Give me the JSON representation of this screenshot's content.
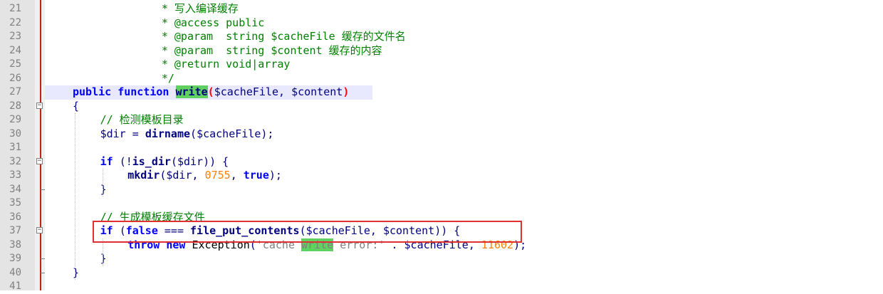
{
  "editor": {
    "lines": [
      {
        "n": "21",
        "tokens": [
          [
            "c-comment",
            " * 写入编译缓存"
          ]
        ],
        "indent": 12
      },
      {
        "n": "22",
        "tokens": [
          [
            "c-comment",
            " * @access public"
          ]
        ],
        "indent": 12
      },
      {
        "n": "23",
        "tokens": [
          [
            "c-comment",
            " * @param  string $cacheFile 缓存的文件名"
          ]
        ],
        "indent": 12
      },
      {
        "n": "24",
        "tokens": [
          [
            "c-comment",
            " * @param  string $content 缓存的内容"
          ]
        ],
        "indent": 12
      },
      {
        "n": "25",
        "tokens": [
          [
            "c-comment",
            " * @return void|array"
          ]
        ],
        "indent": 12
      },
      {
        "n": "26",
        "tokens": [
          [
            "c-comment",
            " */"
          ]
        ],
        "indent": 12
      },
      {
        "n": "27",
        "tokens": [
          [
            "c-kw",
            "public"
          ],
          [
            "c-plain",
            " "
          ],
          [
            "c-kw",
            "function"
          ],
          [
            "c-plain",
            " "
          ],
          [
            "c-fn hl-word",
            "write"
          ],
          [
            "c-brace-hl",
            "("
          ],
          [
            "c-var",
            "$cacheFile"
          ],
          [
            "c-op",
            ", "
          ],
          [
            "c-var",
            "$content"
          ],
          [
            "c-brace-hl",
            ")"
          ]
        ],
        "indent": 0
      },
      {
        "n": "28",
        "tokens": [
          [
            "c-paren",
            "{"
          ]
        ],
        "indent": 0
      },
      {
        "n": "29",
        "tokens": [
          [
            "c-comment",
            "// 检测模板目录"
          ]
        ],
        "indent": 4
      },
      {
        "n": "30",
        "tokens": [
          [
            "c-var",
            "$dir"
          ],
          [
            "c-op",
            " = "
          ],
          [
            "c-fn",
            "dirname"
          ],
          [
            "c-paren",
            "("
          ],
          [
            "c-var",
            "$cacheFile"
          ],
          [
            "c-paren",
            ");"
          ]
        ],
        "indent": 4
      },
      {
        "n": "31",
        "tokens": [],
        "indent": 4
      },
      {
        "n": "32",
        "tokens": [
          [
            "c-kw",
            "if"
          ],
          [
            "c-plain",
            " "
          ],
          [
            "c-paren",
            "(!"
          ],
          [
            "c-fn",
            "is_dir"
          ],
          [
            "c-paren",
            "("
          ],
          [
            "c-var",
            "$dir"
          ],
          [
            "c-paren",
            ")) {"
          ]
        ],
        "indent": 4
      },
      {
        "n": "33",
        "tokens": [
          [
            "c-fn",
            "mkdir"
          ],
          [
            "c-paren",
            "("
          ],
          [
            "c-var",
            "$dir"
          ],
          [
            "c-op",
            ", "
          ],
          [
            "c-num",
            "0755"
          ],
          [
            "c-op",
            ", "
          ],
          [
            "c-kw",
            "true"
          ],
          [
            "c-paren",
            ");"
          ]
        ],
        "indent": 8
      },
      {
        "n": "34",
        "tokens": [
          [
            "c-paren",
            "}"
          ]
        ],
        "indent": 4
      },
      {
        "n": "35",
        "tokens": [],
        "indent": 4
      },
      {
        "n": "36",
        "tokens": [
          [
            "c-comment",
            "// 生成模板缓存文件"
          ]
        ],
        "indent": 4
      },
      {
        "n": "37",
        "tokens": [
          [
            "c-kw",
            "if"
          ],
          [
            "c-plain",
            " "
          ],
          [
            "c-paren",
            "("
          ],
          [
            "c-kw",
            "false"
          ],
          [
            "c-op",
            " === "
          ],
          [
            "c-fn",
            "file_put_contents"
          ],
          [
            "c-paren",
            "("
          ],
          [
            "c-var",
            "$cacheFile"
          ],
          [
            "c-op",
            ", "
          ],
          [
            "c-var",
            "$content"
          ],
          [
            "c-paren",
            ")) {"
          ]
        ],
        "indent": 4
      },
      {
        "n": "38",
        "tokens": [
          [
            "c-kw",
            "throw"
          ],
          [
            "c-plain",
            " "
          ],
          [
            "c-kw",
            "new"
          ],
          [
            "c-plain",
            " Exception"
          ],
          [
            "c-paren",
            "("
          ],
          [
            "c-str",
            "'cache "
          ],
          [
            "c-str hl-word",
            "write"
          ],
          [
            "c-str",
            " error:'"
          ],
          [
            "c-op",
            " . "
          ],
          [
            "c-var",
            "$cacheFile"
          ],
          [
            "c-op",
            ", "
          ],
          [
            "c-num",
            "11602"
          ],
          [
            "c-paren",
            ");"
          ]
        ],
        "indent": 8
      },
      {
        "n": "39",
        "tokens": [
          [
            "c-paren",
            "}"
          ]
        ],
        "indent": 4
      },
      {
        "n": "40",
        "tokens": [
          [
            "c-paren",
            "}"
          ]
        ],
        "indent": 0
      },
      {
        "n": "41",
        "tokens": [],
        "indent": 0
      }
    ],
    "fold_markers": {
      "28": "minus",
      "32": "minus",
      "37": "minus"
    },
    "fold_ends": [
      "34",
      "39",
      "40"
    ],
    "current_line": "27"
  },
  "colors": {
    "highlight_box": "#e03030",
    "current_line_bg": "#e8e8ff",
    "word_highlight": "#60d060"
  }
}
